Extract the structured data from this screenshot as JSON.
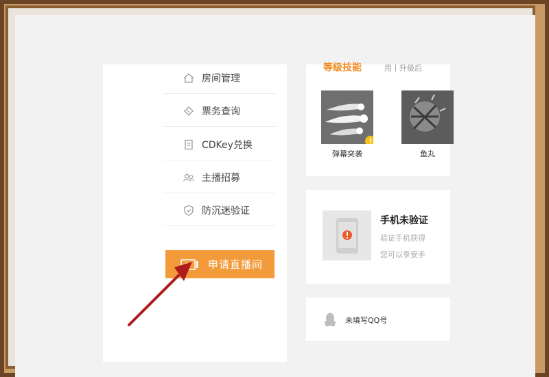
{
  "sidebar": {
    "items": [
      {
        "label": "房间管理",
        "icon": "home-icon"
      },
      {
        "label": "票务查询",
        "icon": "ticket-icon"
      },
      {
        "label": "CDKey兑换",
        "icon": "document-icon"
      },
      {
        "label": "主播招募",
        "icon": "users-icon"
      },
      {
        "label": "防沉迷验证",
        "icon": "shield-check-icon"
      }
    ],
    "apply_button": {
      "label": "申请直播间",
      "icon": "video-play-icon"
    }
  },
  "skills_card": {
    "title": "等级技能",
    "subtitle": "用丨升级后",
    "skills": [
      {
        "name": "弹幕突袭",
        "locked": true
      },
      {
        "name": "鱼丸"
      }
    ]
  },
  "phone_card": {
    "title": "手机未验证",
    "line1": "验证手机获得",
    "line2": "您可以享受手",
    "icon": "phone-alert-icon"
  },
  "qq_card": {
    "text": "未填写QQ号",
    "icon": "qq-penguin-icon"
  },
  "colors": {
    "accent": "#f39b3a",
    "title_orange": "#f08a1e",
    "arrow": "#b01c1c",
    "alert": "#e85d2a",
    "lock": "#f4c21a"
  }
}
